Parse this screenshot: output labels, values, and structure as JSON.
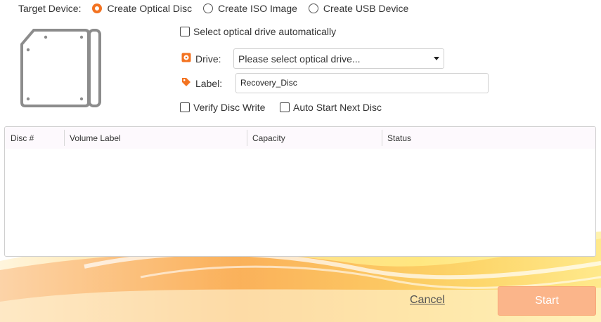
{
  "target": {
    "label": "Target Device:",
    "options": [
      {
        "label": "Create Optical Disc",
        "selected": true
      },
      {
        "label": "Create ISO Image",
        "selected": false
      },
      {
        "label": "Create USB Device",
        "selected": false
      }
    ]
  },
  "options": {
    "auto_select_label": "Select optical drive automatically",
    "auto_select_checked": false,
    "verify_label": "Verify Disc Write",
    "verify_checked": false,
    "auto_start_label": "Auto Start Next Disc",
    "auto_start_checked": false
  },
  "drive": {
    "label": "Drive:",
    "placeholder": "Please select optical drive...",
    "icon": "disc-drive-icon"
  },
  "disc_label": {
    "label": "Label:",
    "value": "Recovery_Disc",
    "icon": "tag-icon"
  },
  "table": {
    "columns": [
      "Disc #",
      "Volume Label",
      "Capacity",
      "Status"
    ],
    "rows": []
  },
  "buttons": {
    "cancel": "Cancel",
    "start": "Start"
  },
  "colors": {
    "accent": "#f37321",
    "start_button": "#fbb58a"
  }
}
